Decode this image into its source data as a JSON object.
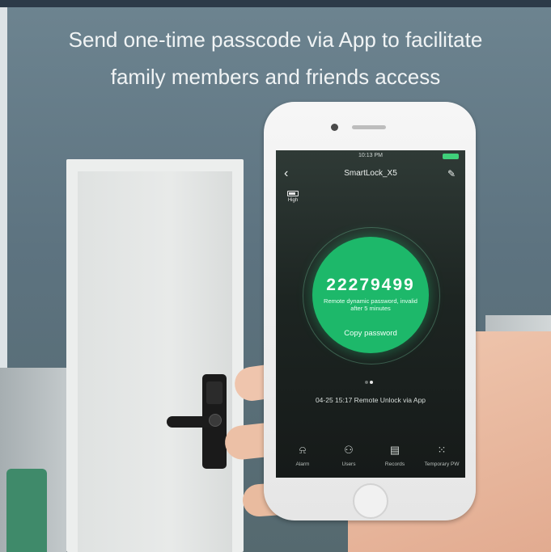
{
  "headline": {
    "line1": "Send one-time passcode via App to facilitate",
    "line2": "family members and friends access"
  },
  "status_bar": {
    "time": "10:13 PM"
  },
  "nav": {
    "back_icon": "chevron-left-icon",
    "title": "SmartLock_X5",
    "edit_icon": "pencil-icon"
  },
  "battery": {
    "icon": "battery-icon",
    "label": "High"
  },
  "passcode_card": {
    "code": "22279499",
    "hint_line1": "Remote dynamic password, invalid",
    "hint_line2": "after 5 minutes",
    "copy_label": "Copy password",
    "color": "#1db86a"
  },
  "pager": {
    "pages": 2,
    "active_index": 1
  },
  "record": {
    "text": "04-25 15:17  Remote Unlock via App"
  },
  "tabs": [
    {
      "icon": "alarm-icon",
      "label": "Alarm"
    },
    {
      "icon": "users-icon",
      "label": "Users"
    },
    {
      "icon": "calendar-icon",
      "label": "Records"
    },
    {
      "icon": "grid-icon",
      "label": "Temporary PW"
    }
  ]
}
